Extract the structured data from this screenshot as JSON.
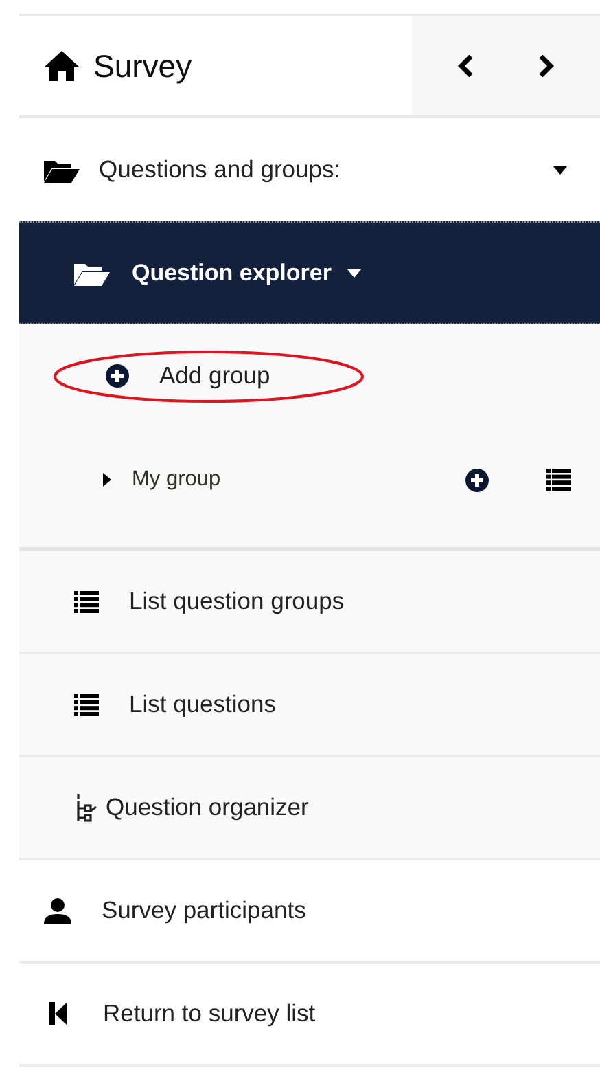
{
  "header": {
    "title": "Survey"
  },
  "section": {
    "label": "Questions and groups:",
    "expanded": true
  },
  "explorer": {
    "label": "Question explorer",
    "selected": true
  },
  "add_group": {
    "label": "Add group",
    "circled": true
  },
  "groups": [
    {
      "label": "My group",
      "expanded": false
    }
  ],
  "subitems": [
    {
      "kind": "list",
      "label": "List question groups"
    },
    {
      "kind": "list",
      "label": "List questions"
    },
    {
      "kind": "organizer",
      "label": "Question organizer"
    }
  ],
  "items": [
    {
      "kind": "user",
      "label": "Survey participants"
    },
    {
      "kind": "back",
      "label": "Return to survey list"
    }
  ]
}
